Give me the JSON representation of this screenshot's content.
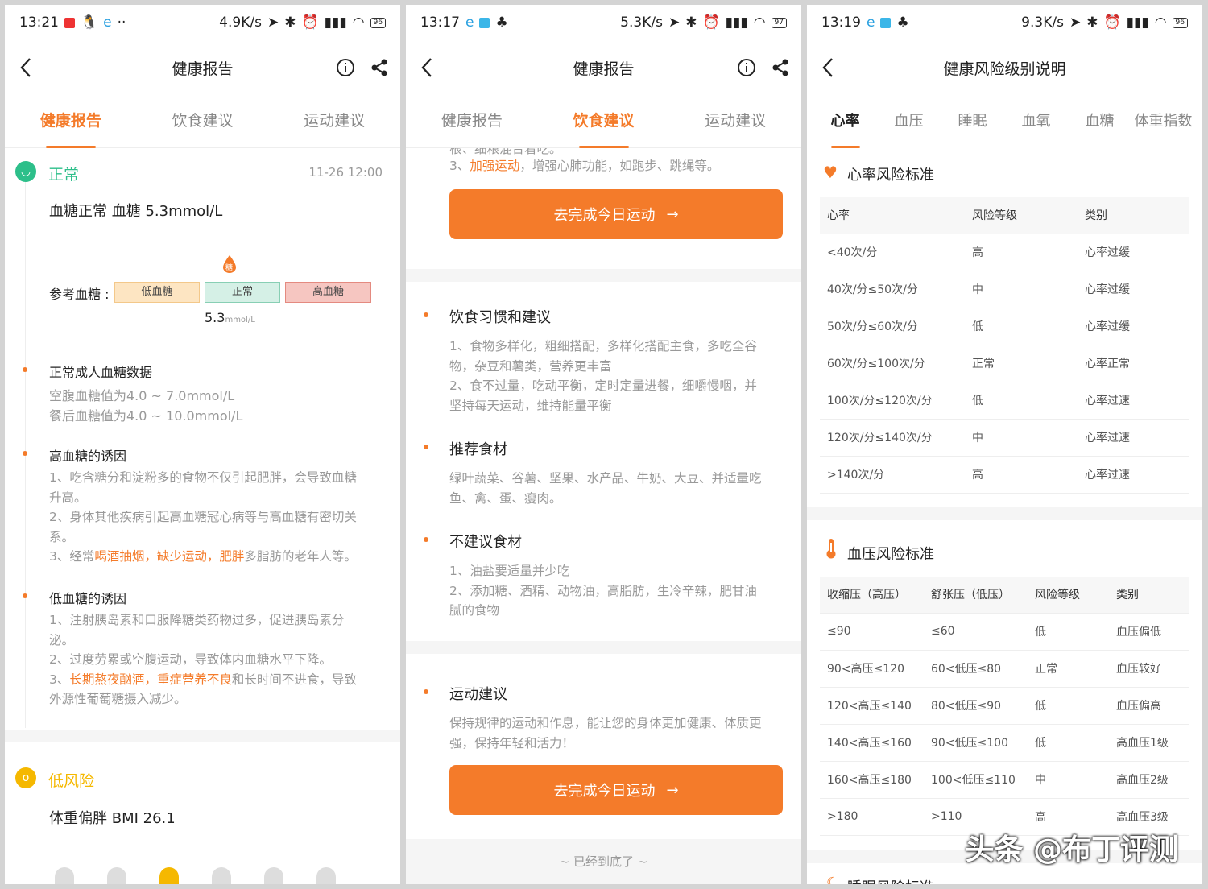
{
  "panel1": {
    "status": {
      "time": "13:21",
      "speed": "4.9K/s",
      "battery": "96"
    },
    "header": {
      "title": "健康报告"
    },
    "tabs": [
      "健康报告",
      "饮食建议",
      "运动建议"
    ],
    "normal": {
      "badge": "正常",
      "date": "11-26 12:00",
      "summary": "血糖正常  血糖 5.3mmol/L",
      "ref_label": "参考血糖 :",
      "marker": "糖",
      "scale": [
        "低血糖",
        "正常",
        "高血糖"
      ],
      "value": "5.3",
      "unit": "mmol/L"
    },
    "sections": [
      {
        "title": "正常成人血糖数据",
        "lines": [
          "空腹血糖值为4.0 ~ 7.0mmol/L",
          "餐后血糖值为4.0 ~ 10.0mmol/L"
        ]
      },
      {
        "title": "高血糖的诱因",
        "lines": [
          "1、吃含糖分和淀粉多的食物不仅引起肥胖，会导致血糖",
          "升高。",
          "2、身体其他疾病引起高血糖冠心病等与高血糖有密切关",
          "系。"
        ],
        "l5a": "3、经常",
        "l5b": "喝酒抽烟，缺少运动，肥胖",
        "l5c": "多脂肪的老年人等。"
      },
      {
        "title": "低血糖的诱因",
        "lines": [
          "1、注射胰岛素和口服降糖类药物过多，促进胰岛素分",
          "泌。",
          "2、过度劳累或空腹运动，导致体内血糖水平下降。"
        ],
        "l4a": "3、",
        "l4b": "长期熬夜酗酒，重症营养不良",
        "l4c": "和长时间不进食，导致",
        "l5": "外源性葡萄糖摄入减少。"
      }
    ],
    "low": {
      "badge": "低风险",
      "summary": "体重偏胖  BMI 26.1"
    }
  },
  "panel2": {
    "status": {
      "time": "13:17",
      "speed": "5.3K/s",
      "battery": "97"
    },
    "header": {
      "title": "健康报告"
    },
    "tabs": [
      "健康报告",
      "饮食建议",
      "运动建议"
    ],
    "top_cut": "根、细粮混合着吃。",
    "top_line_a": "3、",
    "top_line_b": "加强运动",
    "top_line_c": "，增强心肺功能，如跑步、跳绳等。",
    "btn_label": "去完成今日运动",
    "sections": [
      {
        "title": "饮食习惯和建议",
        "lines": [
          "1、食物多样化，粗细搭配，多样化搭配主食，多吃全谷",
          "物，杂豆和薯类，营养更丰富",
          "2、食不过量，吃动平衡，定时定量进餐，细嚼慢咽，并",
          "坚持每天运动，维持能量平衡"
        ]
      },
      {
        "title": "推荐食材",
        "lines": [
          "绿叶蔬菜、谷薯、坚果、水产品、牛奶、大豆、并适量吃",
          "鱼、禽、蛋、瘦肉。"
        ]
      },
      {
        "title": "不建议食材",
        "lines": [
          "1、油盐要适量并少吃",
          "2、添加糖、酒精、动物油，高脂肪，生冷辛辣，肥甘油",
          "腻的食物"
        ]
      },
      {
        "title": "运动建议",
        "lines": [
          "保持规律的运动和作息，能让您的身体更加健康、体质更",
          "强，保持年轻和活力！"
        ]
      }
    ],
    "footer": "~ 已经到底了 ~"
  },
  "panel3": {
    "status": {
      "time": "13:19",
      "speed": "9.3K/s",
      "battery": "96"
    },
    "header": {
      "title": "健康风险级别说明"
    },
    "tabs": [
      "心率",
      "血压",
      "睡眠",
      "血氧",
      "血糖",
      "体重指数"
    ],
    "hr": {
      "title": "心率风险标准",
      "cols": [
        "心率",
        "风险等级",
        "类别"
      ],
      "rows": [
        [
          "<40次/分",
          "高",
          "心率过缓"
        ],
        [
          "40次/分≤50次/分",
          "中",
          "心率过缓"
        ],
        [
          "50次/分≤60次/分",
          "低",
          "心率过缓"
        ],
        [
          "60次/分≤100次/分",
          "正常",
          "心率正常"
        ],
        [
          "100次/分≤120次/分",
          "低",
          "心率过速"
        ],
        [
          "120次/分≤140次/分",
          "中",
          "心率过速"
        ],
        [
          ">140次/分",
          "高",
          "心率过速"
        ]
      ]
    },
    "bp": {
      "title": "血压风险标准",
      "cols": [
        "收缩压（高压）",
        "舒张压（低压）",
        "风险等级",
        "类别"
      ],
      "rows": [
        [
          "≤90",
          "≤60",
          "低",
          "血压偏低"
        ],
        [
          "90<高压≤120",
          "60<低压≤80",
          "正常",
          "血压较好"
        ],
        [
          "120<高压≤140",
          "80<低压≤90",
          "低",
          "血压偏高"
        ],
        [
          "140<高压≤160",
          "90<低压≤100",
          "低",
          "高血压1级"
        ],
        [
          "160<高压≤180",
          "100<低压≤110",
          "中",
          "高血压2级"
        ],
        [
          ">180",
          ">110",
          "高",
          "高血压3级"
        ]
      ]
    },
    "next_title": "睡眠风险标准",
    "watermark": "头条 @布丁评测"
  },
  "colors": {
    "accent": "#f47b2a",
    "normal_green": "#2dbf8a",
    "low_yellow": "#f5b800"
  }
}
